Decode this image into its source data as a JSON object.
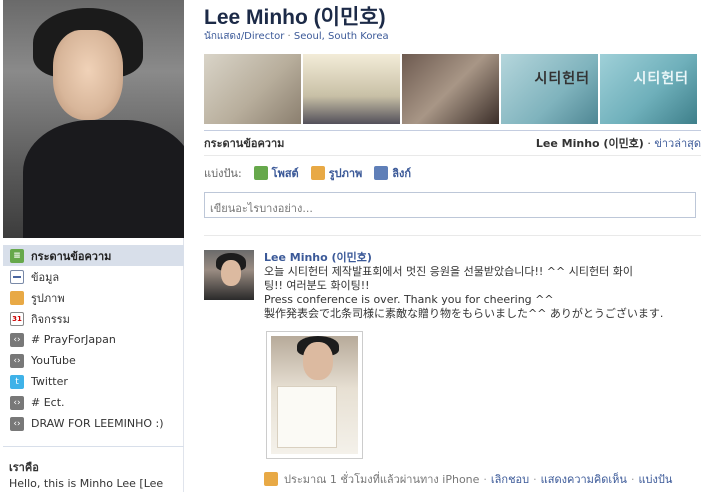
{
  "sidebar": {
    "items": [
      {
        "label": "กระดานข้อความ",
        "icon": "wall-icon",
        "active": true
      },
      {
        "label": "ข้อมูล",
        "icon": "info-icon",
        "active": false
      },
      {
        "label": "รูปภาพ",
        "icon": "photo-icon",
        "active": false
      },
      {
        "label": "กิจกรรม",
        "icon": "calendar-icon",
        "active": false
      },
      {
        "label": "# PrayForJapan",
        "icon": "app-icon",
        "active": false
      },
      {
        "label": "YouTube",
        "icon": "app-icon",
        "active": false
      },
      {
        "label": "Twitter",
        "icon": "twitter-icon",
        "active": false
      },
      {
        "label": "# Ect.",
        "icon": "app-icon",
        "active": false
      },
      {
        "label": "DRAW FOR LEEMINHO :)",
        "icon": "app-icon",
        "active": false
      }
    ],
    "about_title": "เราคือ",
    "about_text": "Hello, this is Minho Lee [Lee"
  },
  "profile": {
    "name": "Lee Minho (이민호)",
    "subtitle_left": "นักแสดง/Director",
    "subtitle_sep": "·",
    "subtitle_location": "Seoul, South Korea",
    "thumb_texts": [
      "",
      "",
      "",
      "시티헌터",
      "시티헌터"
    ]
  },
  "wall": {
    "header_left": "กระดานข้อความ",
    "header_right_name": "Lee Minho (이민호)",
    "header_right_sep": "·",
    "header_right_link": "ข่าวล่าสุด"
  },
  "share": {
    "label": "แบ่งปัน:",
    "options": [
      "โพสต์",
      "รูปภาพ",
      "ลิงก์"
    ]
  },
  "status": {
    "placeholder": "เขียนอะไรบางอย่าง..."
  },
  "post": {
    "author": "Lee Minho (이민호)",
    "line1": "오늘 시티헌터 제작발표회에서 멋진 응원을 선물받았습니다!! ^^ 시티헌터 화이",
    "line2": "팅!! 여러분도 화이팅!!",
    "line3": "Press conference is over. Thank you for cheering ^^",
    "line4": "製作発表会で北条司様に素敵な贈り物をもらいました^^ ありがとうございます.",
    "time": "ประมาณ 1 ชั่วโมงที่แล้วผ่านทาง iPhone",
    "dot": "·",
    "actions": [
      "เลิกชอบ",
      "แสดงความคิดเห็น",
      "แบ่งปัน"
    ]
  },
  "colors": {
    "link": "#3b5998",
    "title": "#1c2a47",
    "active_nav": "#d8dfea"
  }
}
